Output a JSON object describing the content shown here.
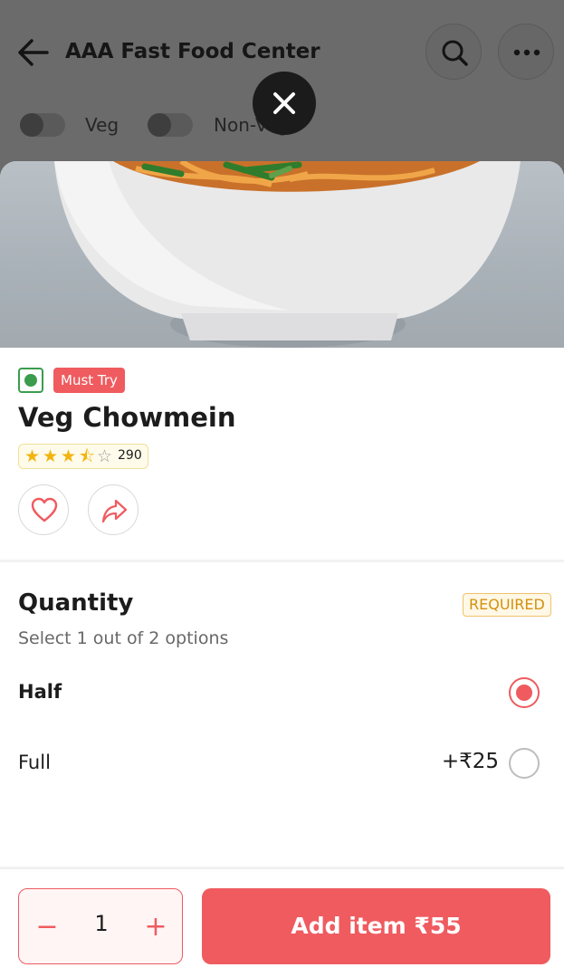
{
  "background": {
    "title": "AAA Fast Food Center",
    "filters": [
      {
        "label": "Veg"
      },
      {
        "label": "Non-Veg"
      }
    ]
  },
  "item": {
    "badge": "Must Try",
    "name": "Veg Chowmein",
    "rating": 3.5,
    "rating_count": "290"
  },
  "quantity": {
    "title": "Quantity",
    "required_label": "REQUIRED",
    "subtitle": "Select 1 out of 2 options",
    "options": [
      {
        "label": "Half",
        "price": "",
        "selected": true
      },
      {
        "label": "Full",
        "price": "+₹25",
        "selected": false
      }
    ]
  },
  "footer": {
    "count": "1",
    "add_label": "Add item ₹55"
  },
  "colors": {
    "accent": "#ef5b5f",
    "veg_green": "#3a9d4e",
    "star": "#f2b40f"
  }
}
